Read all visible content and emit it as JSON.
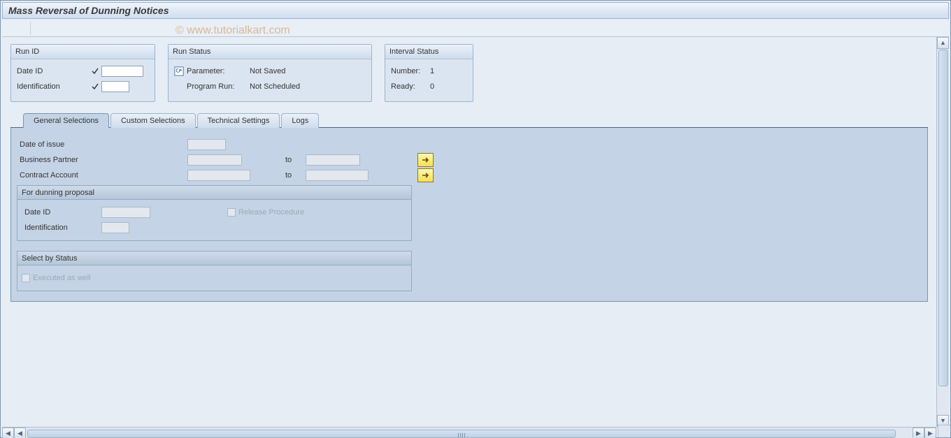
{
  "title": "Mass Reversal of Dunning Notices",
  "watermark": "© www.tutorialkart.com",
  "toolbar": {
    "pencil_name": "edit-icon",
    "wrench_name": "variant-icon",
    "list_name": "list-icon"
  },
  "groups": {
    "run_id": {
      "title": "Run ID",
      "date_id_label": "Date ID",
      "identification_label": "Identification",
      "date_id_value": "",
      "identification_value": ""
    },
    "run_status": {
      "title": "Run Status",
      "parameter_label": "Parameter:",
      "parameter_value": "Not Saved",
      "program_run_label": "Program Run:",
      "program_run_value": "Not Scheduled"
    },
    "interval_status": {
      "title": "Interval Status",
      "number_label": "Number:",
      "number_value": "1",
      "ready_label": "Ready:",
      "ready_value": "0"
    }
  },
  "tabs": {
    "general": "General Selections",
    "custom": "Custom Selections",
    "technical": "Technical Settings",
    "logs": "Logs"
  },
  "form": {
    "date_of_issue_label": "Date of issue",
    "business_partner_label": "Business Partner",
    "contract_account_label": "Contract Account",
    "to_label": "to"
  },
  "dunning": {
    "title": "For dunning proposal",
    "date_id_label": "Date ID",
    "identification_label": "Identification",
    "release_procedure_label": "Release Procedure"
  },
  "status_sel": {
    "title": "Select by Status",
    "executed_label": "Executed as well"
  }
}
